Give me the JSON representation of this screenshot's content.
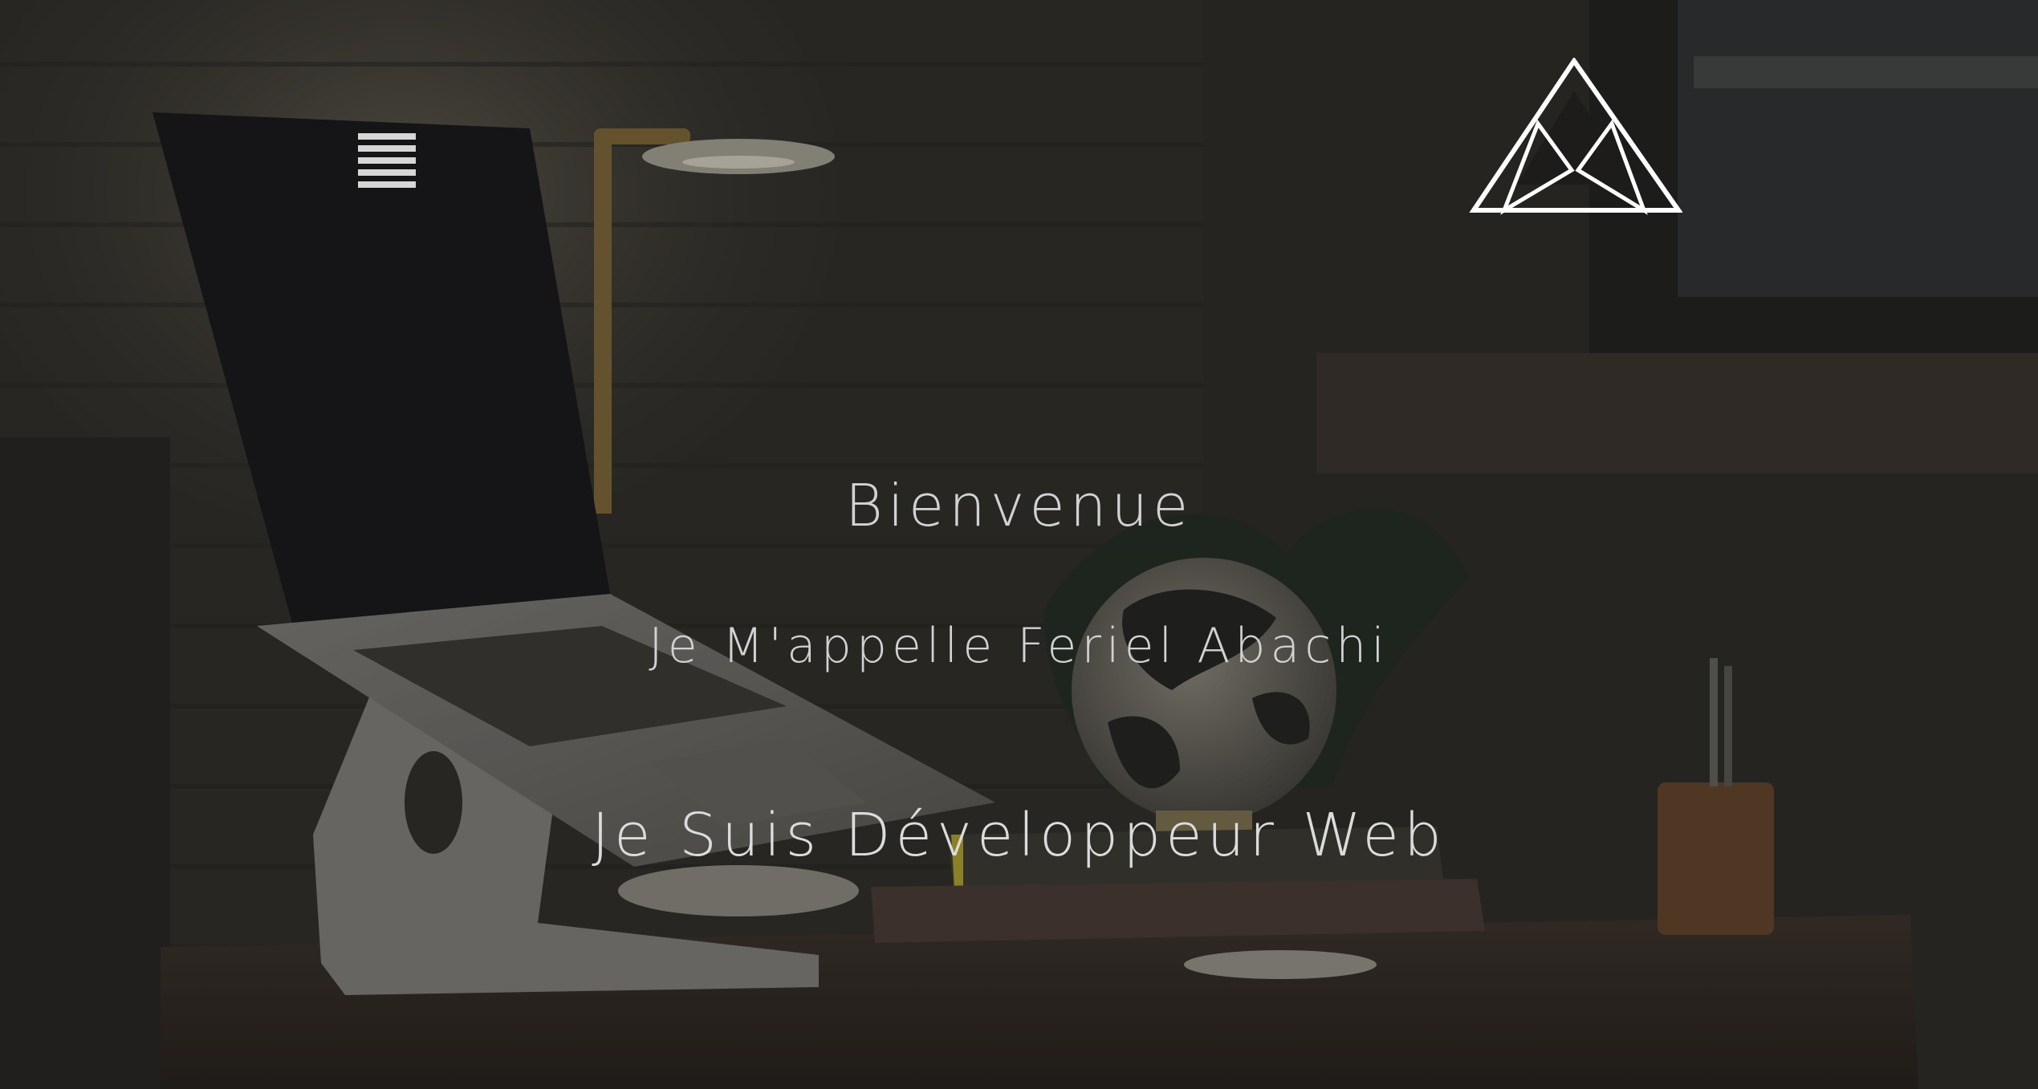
{
  "header": {
    "menu_icon": "hamburger-menu-icon",
    "logo_icon": "mountain-logo-icon"
  },
  "hero": {
    "welcome": "Bienvenue",
    "name_line": "Je M'appelle Feriel Abachi",
    "role_line": "Je Suis Développeur Web"
  },
  "colors": {
    "text": "#d2d2d2",
    "overlay": "#1e1c1a",
    "icon": "#ffffff"
  }
}
